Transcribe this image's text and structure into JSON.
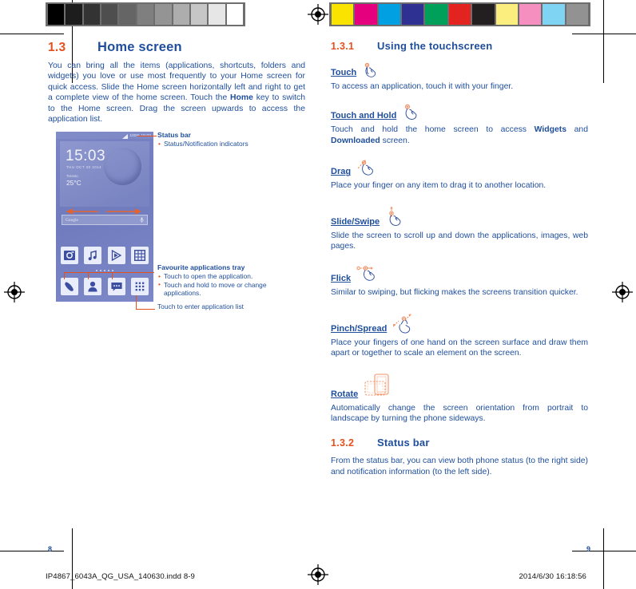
{
  "document": {
    "imprint_left": "IP4867_6043A_QG_USA_140630.indd   8-9",
    "imprint_right": "2014/6/30   16:18:56",
    "page_left": "8",
    "page_right": "9"
  },
  "calibration": {
    "gray_bar_name": "grayscale-calibration-bar",
    "gray_swatches": [
      "#000000",
      "#1d1d1d",
      "#333333",
      "#4e4e4e",
      "#656565",
      "#7f7f7f",
      "#949494",
      "#adadad",
      "#c6c6c6",
      "#e6e6e6",
      "#ffffff"
    ],
    "color_bar_name": "color-calibration-bar",
    "color_swatches": [
      "#fbe300",
      "#e5007e",
      "#00a0e3",
      "#2e3192",
      "#00a05a",
      "#e3231f",
      "#231f20",
      "#fbee7e",
      "#f48fc0",
      "#7fd4f4",
      "#929292"
    ]
  },
  "left_column": {
    "section_number": "1.3",
    "section_title": "Home screen",
    "intro_paragraph_parts": [
      "You can bring all the items (applications, shortcuts, folders and widgets) you love or use most frequently to your Home screen for quick access. Slide the Home screen horizontally left and right to get a complete view of the home screen. Touch the ",
      "Home",
      " key to switch to the Home screen. Drag the screen upwards to access the application list."
    ]
  },
  "phone": {
    "status_bar_text": "100%  15:03",
    "clock": "15:03",
    "date": "THU OCT 30  2014",
    "city": "Toronto",
    "temperature": "25°C",
    "search_placeholder": "Google",
    "app_row_top": [
      "camera-icon",
      "music-icon",
      "play-store-icon",
      "gallery-icon"
    ],
    "app_row_dock": [
      "phone-icon",
      "contacts-icon",
      "messaging-icon",
      "app-list-icon"
    ],
    "page_dots": 5
  },
  "callouts": {
    "status_bar": {
      "title": "Status bar",
      "items": [
        "Status/Notification indicators"
      ]
    },
    "favourite_tray": {
      "title": "Favourite applications tray",
      "items": [
        "Touch to open the application.",
        "Touch and hold to move or change"
      ],
      "item_continuation": "applications.",
      "plain": "Touch to enter application list"
    }
  },
  "right_column": {
    "section_1": {
      "number": "1.3.1",
      "title": "Using the touchscreen"
    },
    "gestures": [
      {
        "term": "Touch",
        "icon": "touch-hand-icon",
        "body_parts": [
          "To access an application, touch it with your finger."
        ]
      },
      {
        "term": "Touch and Hold",
        "icon": "touch-hold-hand-icon",
        "body_parts": [
          "Touch and hold the home screen to access ",
          "Widgets",
          " and ",
          "Downloaded",
          " screen."
        ]
      },
      {
        "term": "Drag",
        "icon": "drag-hand-icon",
        "body_parts": [
          "Place your finger on any item to drag it to another location."
        ]
      },
      {
        "term": "Slide/Swipe",
        "icon": "slide-hand-icon",
        "body_parts": [
          "Slide the screen to scroll up and down the applications, images, web pages."
        ]
      },
      {
        "term": "Flick",
        "icon": "flick-hand-icon",
        "body_parts": [
          "Similar to swiping, but flicking makes the screens transition quicker."
        ]
      },
      {
        "term": "Pinch/Spread",
        "icon": "pinch-spread-hand-icon",
        "body_parts": [
          "Place your fingers of one hand on the screen surface and draw them apart or together to scale an element on the screen."
        ]
      },
      {
        "term": "Rotate",
        "icon": "rotate-phone-icon",
        "body_parts": [
          "Automatically change the screen orientation from portrait to landscape by turning the phone sideways."
        ]
      }
    ],
    "section_2": {
      "number": "1.3.2",
      "title": "Status bar",
      "body": "From the status bar, you can view both phone status (to the right side) and notification information (to the left side)."
    }
  },
  "colors": {
    "accent_orange": "#e4511e",
    "body_blue": "#1f4e9c"
  }
}
